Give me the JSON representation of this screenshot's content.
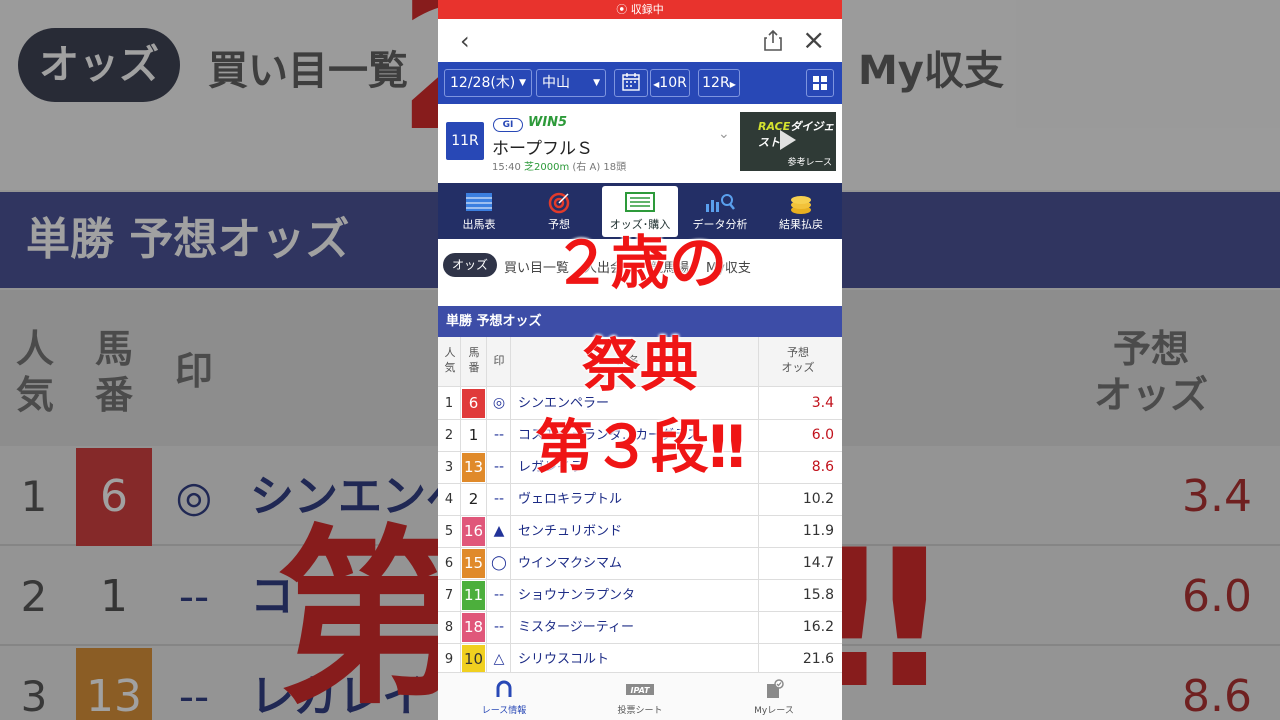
{
  "recording_label": "収録中",
  "toolbar": {
    "date": "12/28(木)",
    "venue": "中山",
    "prev_race": "10R",
    "next_race": "12R"
  },
  "race": {
    "number": "11R",
    "grade": "GI",
    "win5": "WIN5",
    "name": "ホープフルＳ",
    "time": "15:40",
    "surface_dist": "芝2000m",
    "meta_rest": "(右 A) 18頭",
    "video_title_a": "RACE",
    "video_title_b": "ダイジェスト",
    "video_caption": "参考レース"
  },
  "tabs": [
    {
      "label": "出馬表",
      "icon": "table-icon"
    },
    {
      "label": "予想",
      "icon": "target-icon"
    },
    {
      "label": "オッズ･購入",
      "icon": "ipat-icon"
    },
    {
      "label": "データ分析",
      "icon": "chart-search-icon"
    },
    {
      "label": "結果払戻",
      "icon": "coins-icon"
    }
  ],
  "subnav": {
    "active": "オッズ",
    "links": [
      "買い目一覧",
      "人出会",
      "競馬場",
      "My収支"
    ]
  },
  "odds": {
    "band_title": "単勝 予想オッズ",
    "header_pop": "人\n気",
    "header_num": "馬\n番",
    "header_mark": "印",
    "header_name": "馬名",
    "header_odds": "予想\nオッズ",
    "rows": [
      {
        "pop": "1",
        "num": "6",
        "num_bg": "#e03a3a",
        "num_fg": "#ffffff",
        "mark": "◎",
        "name": "シンエンペラー",
        "odds": "3.4",
        "hi": true
      },
      {
        "pop": "2",
        "num": "1",
        "num_bg": "#ffffff",
        "num_fg": "#222222",
        "mark": "--",
        "name": "コスモキュランダ…カーグラス",
        "odds": "6.0",
        "hi": true
      },
      {
        "pop": "3",
        "num": "13",
        "num_bg": "#e08a2a",
        "num_fg": "#ffffff",
        "mark": "--",
        "name": "レガレイラ",
        "odds": "8.6",
        "hi": true
      },
      {
        "pop": "4",
        "num": "2",
        "num_bg": "#ffffff",
        "num_fg": "#222222",
        "mark": "--",
        "name": "ヴェロキラプトル",
        "odds": "10.2",
        "hi": false
      },
      {
        "pop": "5",
        "num": "16",
        "num_bg": "#e0577a",
        "num_fg": "#ffffff",
        "mark": "▲",
        "name": "センチュリボンド",
        "odds": "11.9",
        "hi": false
      },
      {
        "pop": "6",
        "num": "15",
        "num_bg": "#e08a2a",
        "num_fg": "#ffffff",
        "mark": "◯",
        "name": "ウインマクシマム",
        "odds": "14.7",
        "hi": false
      },
      {
        "pop": "7",
        "num": "11",
        "num_bg": "#4caf3c",
        "num_fg": "#ffffff",
        "mark": "--",
        "name": "ショウナンラプンタ",
        "odds": "15.8",
        "hi": false
      },
      {
        "pop": "8",
        "num": "18",
        "num_bg": "#e0577a",
        "num_fg": "#ffffff",
        "mark": "--",
        "name": "ミスタージーティー",
        "odds": "16.2",
        "hi": false
      },
      {
        "pop": "9",
        "num": "10",
        "num_bg": "#f0d020",
        "num_fg": "#333333",
        "mark": "△",
        "name": "シリウスコルト",
        "odds": "21.6",
        "hi": false
      }
    ]
  },
  "overlay": {
    "line1": "２歳の",
    "line2": "祭典",
    "line3": "第３段‼"
  },
  "bottom_nav": [
    {
      "label": "レース情報",
      "icon": "horseshoe-icon",
      "active": true
    },
    {
      "label": "投票シート",
      "icon": "ipat-icon",
      "active": false
    },
    {
      "label": "Myレース",
      "icon": "my-race-icon",
      "active": false
    }
  ],
  "background": {
    "pill": "オッズ",
    "link1": "買い目一覧",
    "link2": "My収支",
    "band": "単勝 予想オッズ",
    "h_pop": "人\n気",
    "h_num": "馬\n番",
    "h_mark": "印",
    "h_odds": "予想\nオッズ",
    "r1_pop": "1",
    "r1_num": "6",
    "r1_mark": "◎",
    "r1_name": "シンエンペ",
    "r1_odds": "3.4",
    "r2_pop": "2",
    "r2_num": "1",
    "r2_mark": "--",
    "r2_name": "コ",
    "r2_odds": "6.0",
    "r3_pop": "3",
    "r3_num": "13",
    "r3_mark": "--",
    "r3_name": "レガレイ",
    "r3_odds": "8.6",
    "big_left": "第",
    "big_right": "‼"
  }
}
